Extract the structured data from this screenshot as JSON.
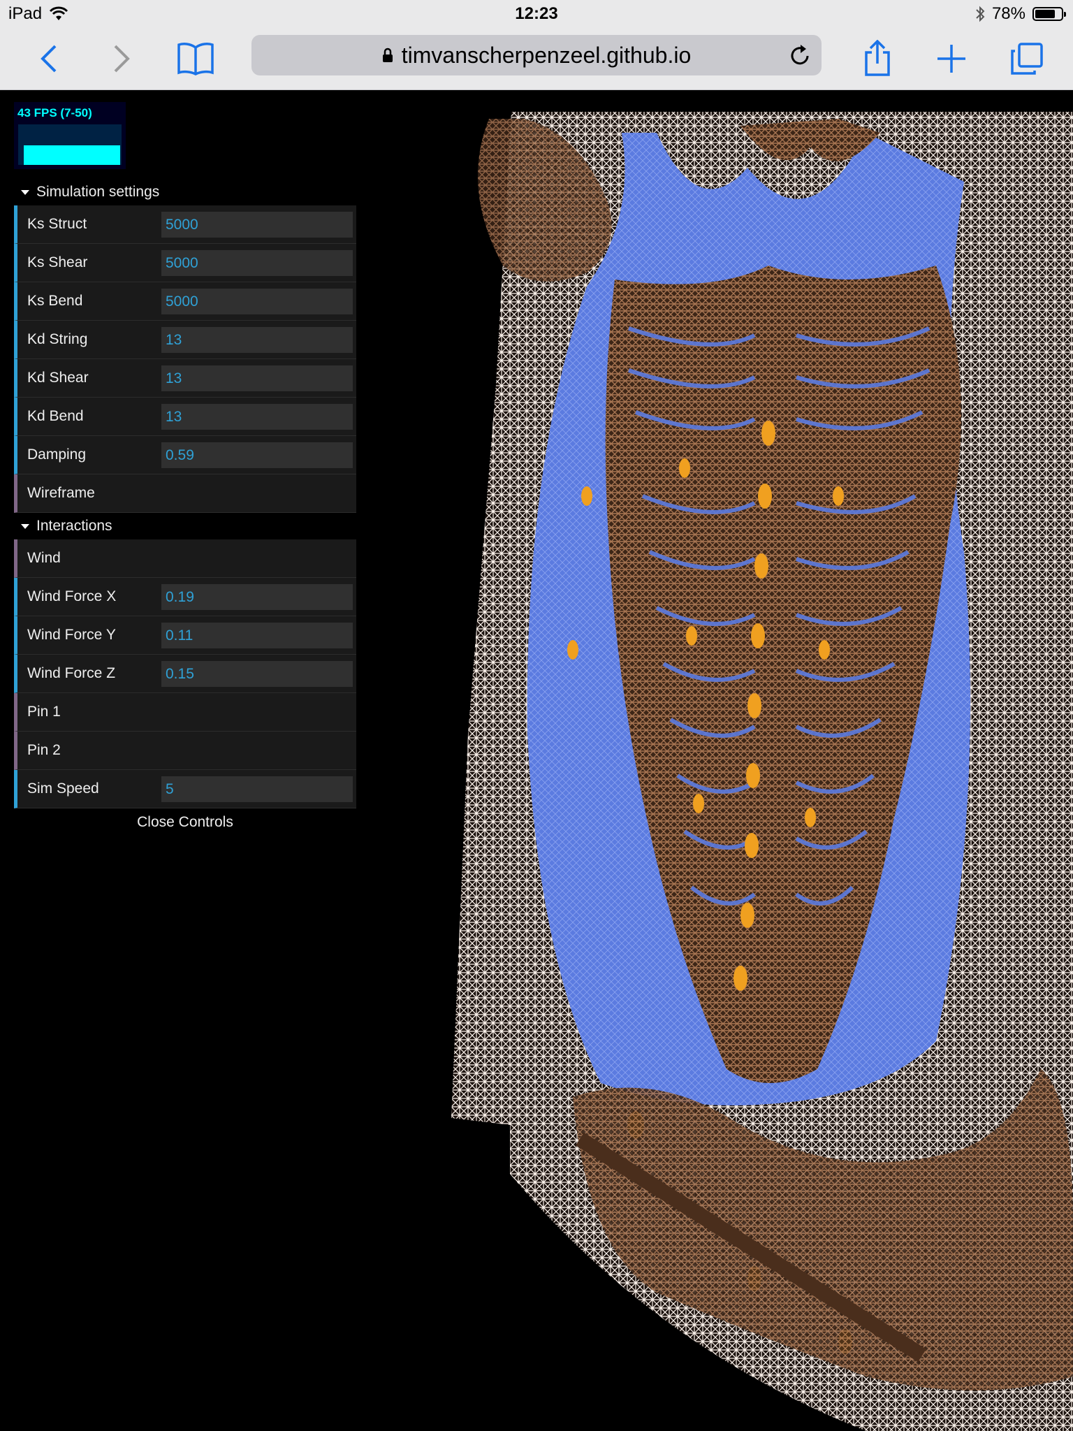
{
  "status_bar": {
    "device": "iPad",
    "time": "12:23",
    "battery": "78%",
    "battery_level": 0.78,
    "icons": [
      "wifi-icon",
      "bluetooth-icon",
      "battery-icon"
    ]
  },
  "browser": {
    "url": "timvanscherpenzeel.github.io",
    "icons": [
      "back-icon",
      "forward-icon",
      "bookmarks-icon",
      "lock-icon",
      "reload-icon",
      "share-icon",
      "new-tab-icon",
      "tabs-icon"
    ]
  },
  "stats": {
    "fps_label": "43 FPS (7-50)"
  },
  "gui": {
    "folders": [
      {
        "title": "Simulation settings",
        "rows": [
          {
            "label": "Ks Struct",
            "value": "5000"
          },
          {
            "label": "Ks Shear",
            "value": "5000"
          },
          {
            "label": "Ks Bend",
            "value": "5000"
          },
          {
            "label": "Kd String",
            "value": "13"
          },
          {
            "label": "Kd Shear",
            "value": "13"
          },
          {
            "label": "Kd Bend",
            "value": "13"
          },
          {
            "label": "Damping",
            "value": "0.59"
          },
          {
            "label": "Wireframe"
          }
        ]
      },
      {
        "title": "Interactions",
        "rows": [
          {
            "label": "Wind"
          },
          {
            "label": "Wind Force X",
            "value": "0.19"
          },
          {
            "label": "Wind Force Y",
            "value": "0.11"
          },
          {
            "label": "Wind Force Z",
            "value": "0.15"
          },
          {
            "label": "Pin 1"
          },
          {
            "label": "Pin 2"
          },
          {
            "label": "Sim Speed",
            "value": "5"
          }
        ]
      }
    ],
    "close_label": "Close Controls"
  },
  "colors": {
    "number_accent": "#2fa1d6",
    "boolean_accent": "#806787",
    "cloth_blue": "#5b7be0",
    "bone_brown": "#7a5238",
    "highlight_orange": "#f0a020"
  }
}
